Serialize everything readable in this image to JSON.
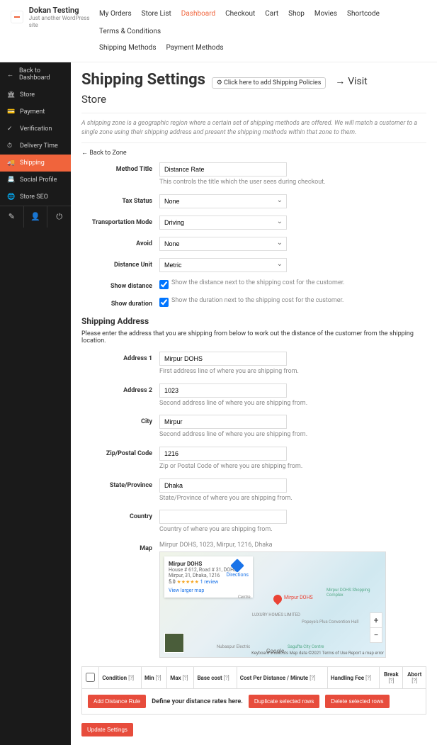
{
  "site": {
    "title": "Dokan Testing",
    "tagline": "Just another WordPress site"
  },
  "nav": {
    "row1": [
      "My Orders",
      "Store List",
      "Dashboard",
      "Checkout",
      "Cart",
      "Shop",
      "Movies",
      "Shortcode",
      "Terms & Conditions"
    ],
    "row2": [
      "Shipping Methods",
      "Payment Methods"
    ],
    "active": "Dashboard"
  },
  "sidebar": {
    "items": [
      {
        "label": "Back to Dashboard"
      },
      {
        "label": "Store"
      },
      {
        "label": "Payment"
      },
      {
        "label": "Verification"
      },
      {
        "label": "Delivery Time"
      },
      {
        "label": "Shipping"
      },
      {
        "label": "Social Profile"
      },
      {
        "label": "Store SEO"
      }
    ]
  },
  "page": {
    "title": "Shipping Settings",
    "policies_btn": "Click here to add Shipping Policies",
    "visit": "Visit",
    "subtitle": "Store",
    "zone_desc": "A shipping zone is a geographic region where a certain set of shipping methods are offered. We will match a customer to a single zone using their shipping address and present the shipping methods within that zone to them.",
    "back_zone": "← Back to Zone"
  },
  "form": {
    "method_title": {
      "label": "Method Title",
      "value": "Distance Rate",
      "help": "This controls the title which the user sees during checkout."
    },
    "tax_status": {
      "label": "Tax Status",
      "value": "None"
    },
    "transport": {
      "label": "Transportation Mode",
      "value": "Driving"
    },
    "avoid": {
      "label": "Avoid",
      "value": "None"
    },
    "dist_unit": {
      "label": "Distance Unit",
      "value": "Metric"
    },
    "show_dist": {
      "label": "Show distance",
      "text": "Show the distance next to the shipping cost for the customer."
    },
    "show_dur": {
      "label": "Show duration",
      "text": "Show the duration next to the shipping cost for the customer."
    }
  },
  "shipping_addr": {
    "heading": "Shipping Address",
    "desc": "Please enter the address that you are shipping from below to work out the distance of the customer from the shipping location.",
    "addr1": {
      "label": "Address 1",
      "value": "Mirpur DOHS",
      "help": "First address line of where you are shipping from."
    },
    "addr2": {
      "label": "Address 2",
      "value": "1023",
      "help": "Second address line of where you are shipping from."
    },
    "city": {
      "label": "City",
      "value": "Mirpur",
      "help": "Second address line of where you are shipping from."
    },
    "zip": {
      "label": "Zip/Postal Code",
      "value": "1216",
      "help": "Zip or Postal Code of where you are shipping from."
    },
    "state": {
      "label": "State/Province",
      "value": "Dhaka",
      "help": "State/Province of where you are shipping from."
    },
    "country": {
      "label": "Country",
      "value": "",
      "help": "Country of where you are shipping from."
    },
    "map": {
      "label": "Map",
      "text": "Mirpur DOHS, 1023, Mirpur, 1216, Dhaka"
    }
  },
  "map_card": {
    "title": "Mirpur DOHS",
    "addr": "House # 612, Road # 31, DOHS Mirpur, 31, Dhaka, 1216",
    "rating": "5.0",
    "stars": "★★★★★",
    "reviews": "1 review",
    "directions": "Directions",
    "larger": "View larger map",
    "pin_label": "Mirpur DOHS"
  },
  "map_labels": {
    "luxury": "LUXURY HOMES LIMITED",
    "nubaspur": "Nubaspur Electric",
    "popeye": "Popeye's Plus Convention Hall",
    "sagufta": "Sagufta City Centre",
    "mirpur_shop": "Mirpur DOHS Shopping Complex",
    "center": "Centre",
    "footer": "Keyboard shortcuts   Map data ©2021   Terms of Use   Report a map error",
    "google": "Google"
  },
  "table": {
    "cols": [
      "",
      "Condition",
      "Min",
      "Max",
      "Base cost",
      "Cost Per Distance / Minute",
      "Handling Fee",
      "Break",
      "Abort"
    ]
  },
  "actions": {
    "add_rule": "Add Distance Rule",
    "define": "Define your distance rates here.",
    "dup": "Duplicate selected rows",
    "del": "Delete selected rows",
    "update": "Update Settings"
  }
}
